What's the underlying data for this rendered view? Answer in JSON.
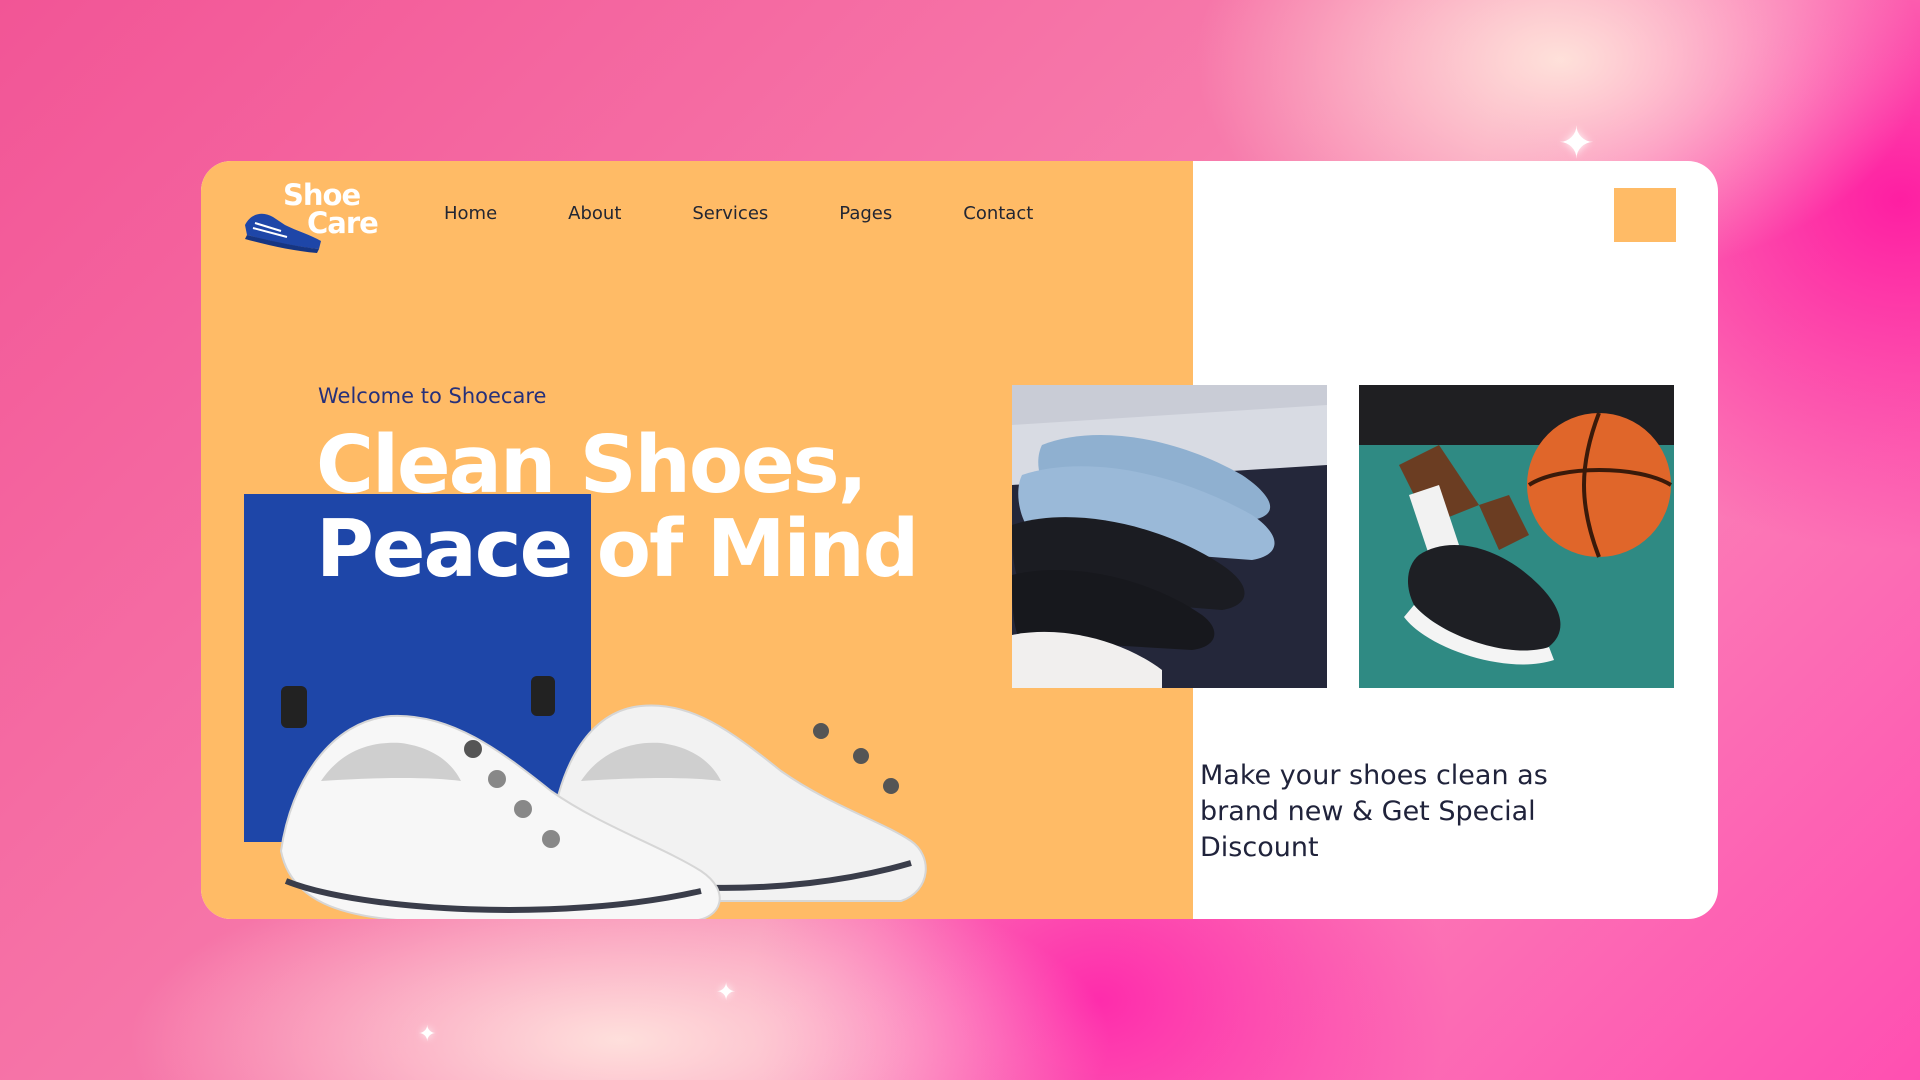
{
  "brand": {
    "line1": "Shoe",
    "line2": "Care"
  },
  "nav": {
    "items": [
      "Home",
      "About",
      "Services",
      "Pages",
      "Contact"
    ]
  },
  "hero": {
    "welcome": "Welcome to Shoecare",
    "headline_line1": "Clean Shoes,",
    "headline_line2": "Peace of Mind"
  },
  "promo": {
    "text": "Make your shoes clean as brand new & Get Special Discount"
  },
  "colors": {
    "accent_orange": "#ffbb66",
    "brand_blue": "#1e46a8",
    "text_dark": "#20233b",
    "background_pink": "#f77aab"
  },
  "icons": {
    "logo": "sneaker-icon",
    "menu": "menu-square-icon",
    "sparkle": "sparkle-icon"
  }
}
